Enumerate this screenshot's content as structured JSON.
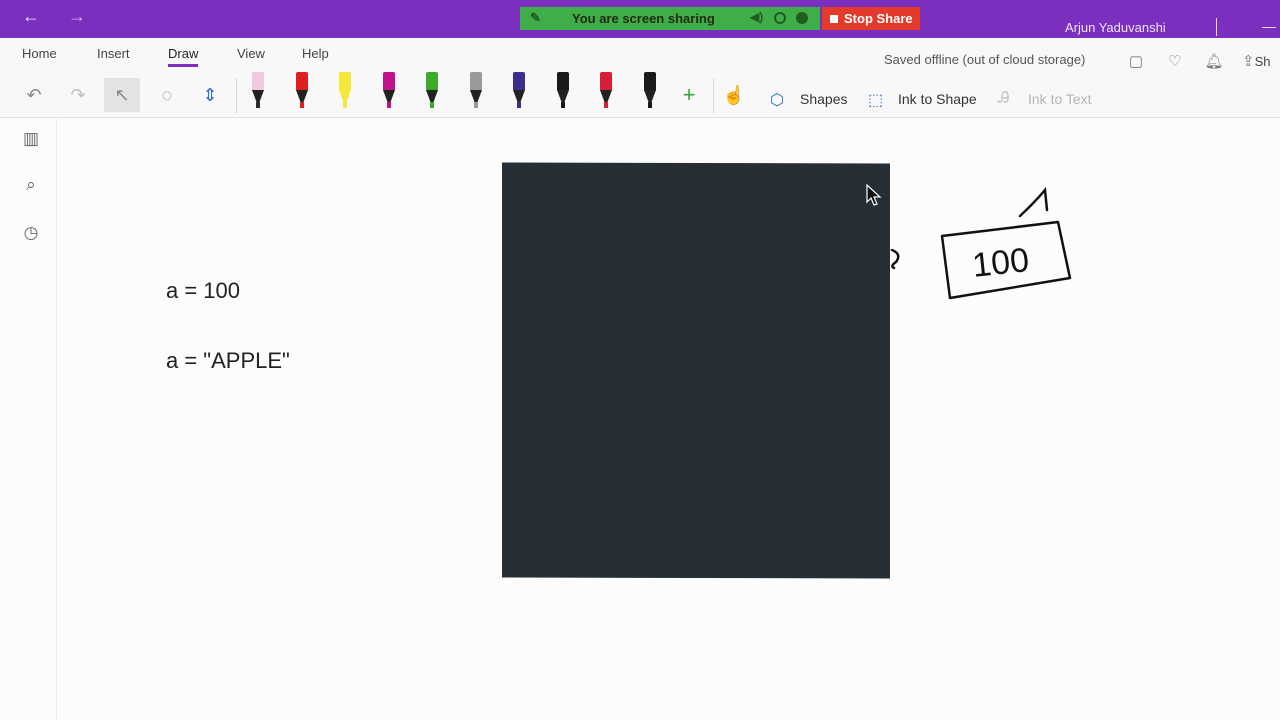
{
  "titlebar": {
    "back_icon": "arrow-left-icon",
    "forward_icon": "arrow-right-icon",
    "share_banner": "You are screen sharing",
    "stop_share": "Stop Share",
    "user": "Arjun Yaduvanshi"
  },
  "ribbon": {
    "tabs": [
      {
        "label": "Home"
      },
      {
        "label": "Insert"
      },
      {
        "label": "Draw"
      },
      {
        "label": "View"
      },
      {
        "label": "Help"
      }
    ],
    "active_tab": "Draw",
    "status": "Saved offline (out of cloud storage)",
    "share_partial": "Sh",
    "shapes": "Shapes",
    "ink_to_shape": "Ink to Shape",
    "ink_to_text": "Ink to Text",
    "pens": [
      {
        "color": "#2b2b2b",
        "cap": "#f0c9e0",
        "type": "eraser"
      },
      {
        "color": "#e02020"
      },
      {
        "color": "#f6e83a",
        "type": "highlighter"
      },
      {
        "color": "#c0138a"
      },
      {
        "color": "#3cab2a"
      },
      {
        "color": "#9a9a9a"
      },
      {
        "color": "#3b2e8f"
      },
      {
        "color": "#1a1a1a"
      },
      {
        "color": "#d81f3a"
      },
      {
        "color": "#1a1a1a",
        "type": "galaxy"
      }
    ]
  },
  "sidebar": {
    "items": [
      {
        "icon": "notebooks-icon"
      },
      {
        "icon": "search-icon"
      },
      {
        "icon": "recent-clock-icon"
      }
    ]
  },
  "page": {
    "line1": "a = 100",
    "line2": "a = \"APPLE\"",
    "ink_value": "100"
  },
  "colors": {
    "brand": "#7a2fbf",
    "share_green": "#3fae49",
    "stop_red": "#e23b2b",
    "dark_box": "#262f36"
  }
}
